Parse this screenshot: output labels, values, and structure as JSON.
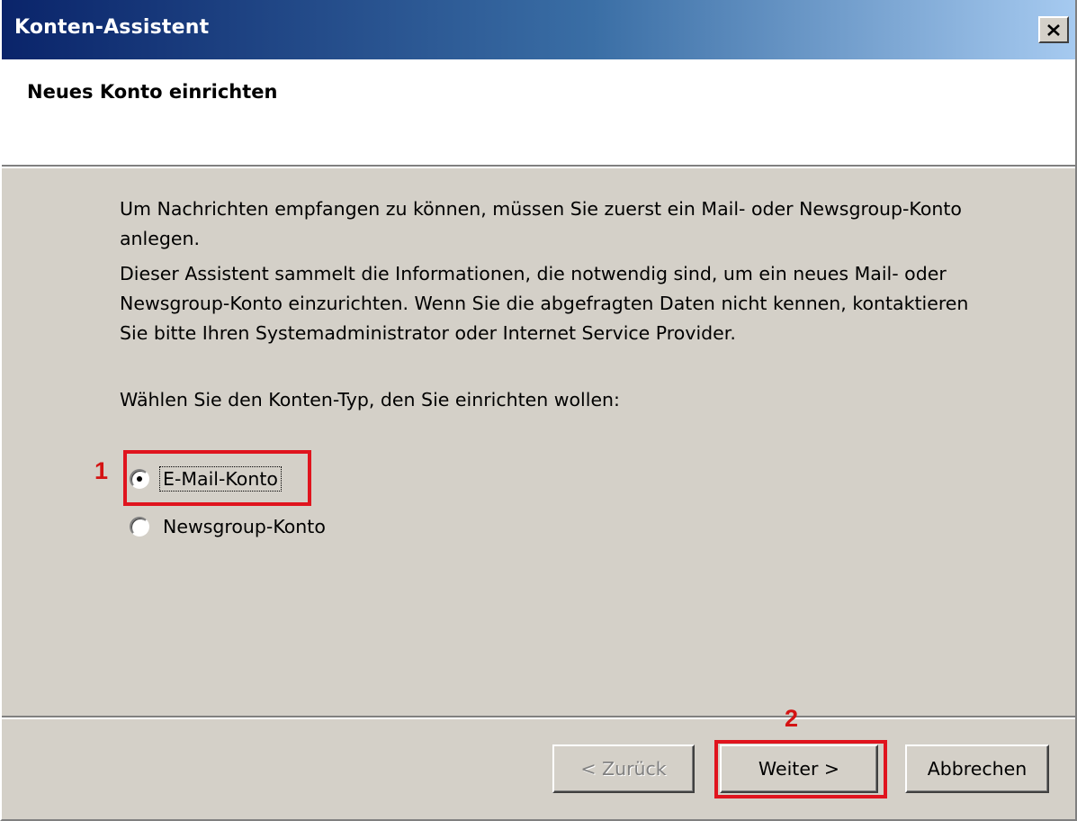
{
  "window": {
    "title": "Konten-Assistent",
    "close_icon": "close-icon"
  },
  "header": {
    "title": "Neues Konto einrichten"
  },
  "body": {
    "intro": "Um Nachrichten empfangen zu können, müssen Sie zuerst ein Mail- oder Newsgroup-Konto anlegen.",
    "description": "Dieser Assistent sammelt die Informationen, die notwendig sind, um ein neues Mail- oder Newsgroup-Konto einzurichten. Wenn Sie die abgefragten Daten nicht kennen, kontaktieren Sie bitte Ihren Systemadministrator oder Internet Service Provider.",
    "prompt": "Wählen Sie den Konten-Typ, den Sie einrichten wollen:"
  },
  "options": {
    "email": {
      "label": "E-Mail-Konto",
      "selected": true
    },
    "newsgroup": {
      "label": "Newsgroup-Konto",
      "selected": false
    }
  },
  "buttons": {
    "back": {
      "label": "< Zurück",
      "enabled": false
    },
    "next": {
      "label": "Weiter >",
      "enabled": true
    },
    "cancel": {
      "label": "Abbrechen",
      "enabled": true
    }
  },
  "annotations": {
    "marker_1": "1",
    "marker_2": "2",
    "marker_color": "#e0141e"
  },
  "colors": {
    "title_gradient_start": "#0a246a",
    "title_gradient_end": "#a6caf0",
    "dialog_face": "#d4d0c8"
  }
}
